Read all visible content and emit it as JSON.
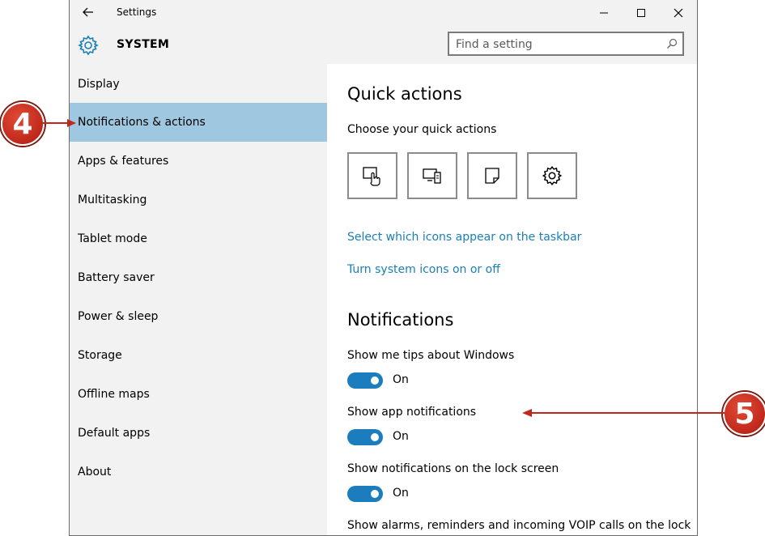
{
  "window": {
    "title": "Settings"
  },
  "header": {
    "title": "SYSTEM",
    "search_placeholder": "Find a setting"
  },
  "sidebar": {
    "items": [
      {
        "label": "Display"
      },
      {
        "label": "Notifications & actions",
        "active": true
      },
      {
        "label": "Apps & features"
      },
      {
        "label": "Multitasking"
      },
      {
        "label": "Tablet mode"
      },
      {
        "label": "Battery saver"
      },
      {
        "label": "Power & sleep"
      },
      {
        "label": "Storage"
      },
      {
        "label": "Offline maps"
      },
      {
        "label": "Default apps"
      },
      {
        "label": "About"
      }
    ]
  },
  "quick_actions": {
    "heading": "Quick actions",
    "subheading": "Choose your quick actions",
    "tiles": [
      {
        "icon": "tablet-mode-icon"
      },
      {
        "icon": "connect-icon"
      },
      {
        "icon": "note-icon"
      },
      {
        "icon": "all-settings-icon"
      }
    ],
    "links": [
      "Select which icons appear on the taskbar",
      "Turn system icons on or off"
    ]
  },
  "notifications": {
    "heading": "Notifications",
    "settings": [
      {
        "label": "Show me tips about Windows",
        "state": "On",
        "on": true
      },
      {
        "label": "Show app notifications",
        "state": "On",
        "on": true
      },
      {
        "label": "Show notifications on the lock screen",
        "state": "On",
        "on": true
      },
      {
        "label": "Show alarms, reminders and incoming VOIP calls on the lock"
      }
    ]
  },
  "callouts": {
    "step4": "4",
    "step5": "5"
  },
  "colors": {
    "accent": "#1b7dbd",
    "selected": "#9fc8e0",
    "link": "#1a7fb5",
    "callout": "#c0281b"
  }
}
